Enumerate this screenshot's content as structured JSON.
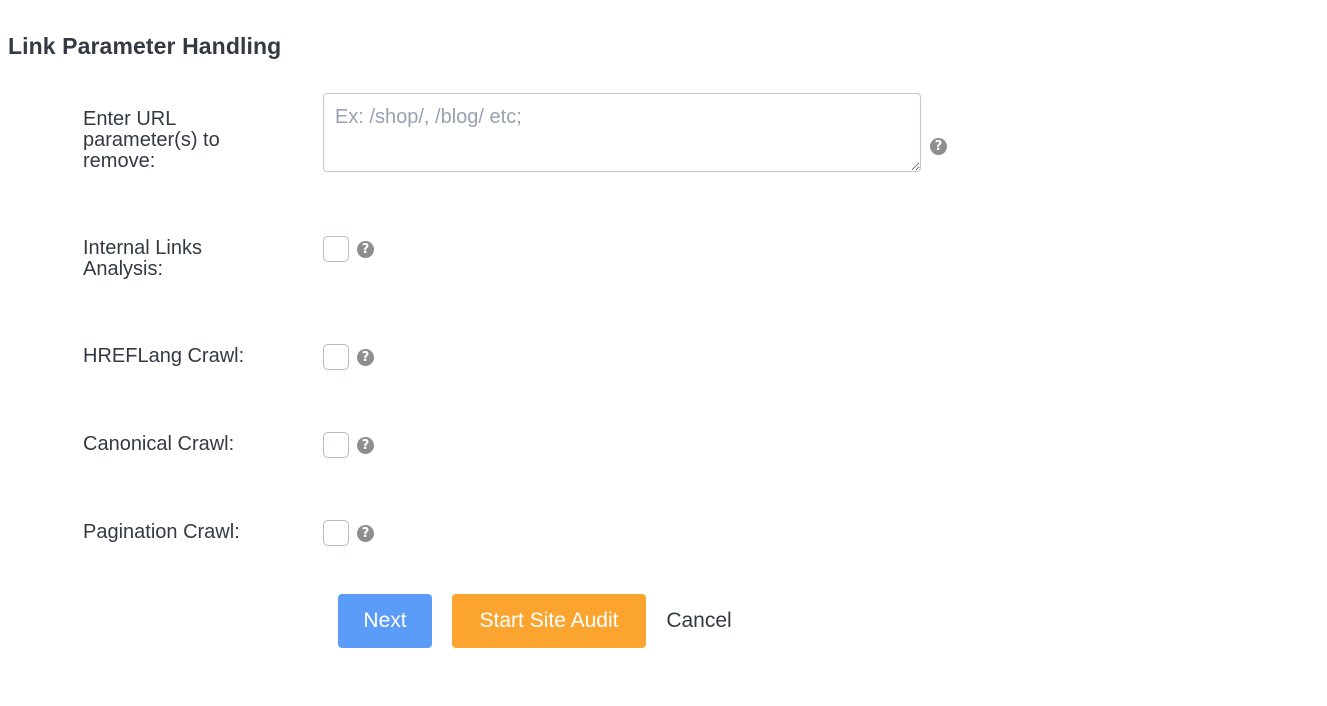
{
  "section": {
    "title": "Link Parameter Handling"
  },
  "fields": {
    "url_params": {
      "label": "Enter URL parameter(s) to remove:",
      "placeholder": "Ex: /shop/, /blog/ etc;",
      "value": ""
    },
    "internal_links": {
      "label": "Internal Links Analysis:",
      "checked": false
    },
    "hreflang": {
      "label": "HREFLang Crawl:",
      "checked": false
    },
    "canonical": {
      "label": "Canonical Crawl:",
      "checked": false
    },
    "pagination": {
      "label": "Pagination Crawl:",
      "checked": false
    }
  },
  "help_icon": {
    "glyph": "?",
    "icon": "question-circle-icon",
    "color": "#8e8e8e"
  },
  "buttons": {
    "next_label": "Next",
    "start_label": "Start Site Audit",
    "cancel_label": "Cancel"
  },
  "colors": {
    "next_button": "#5b9cf8",
    "start_button": "#fba530",
    "text": "#333a44",
    "placeholder": "#98a2b3"
  }
}
